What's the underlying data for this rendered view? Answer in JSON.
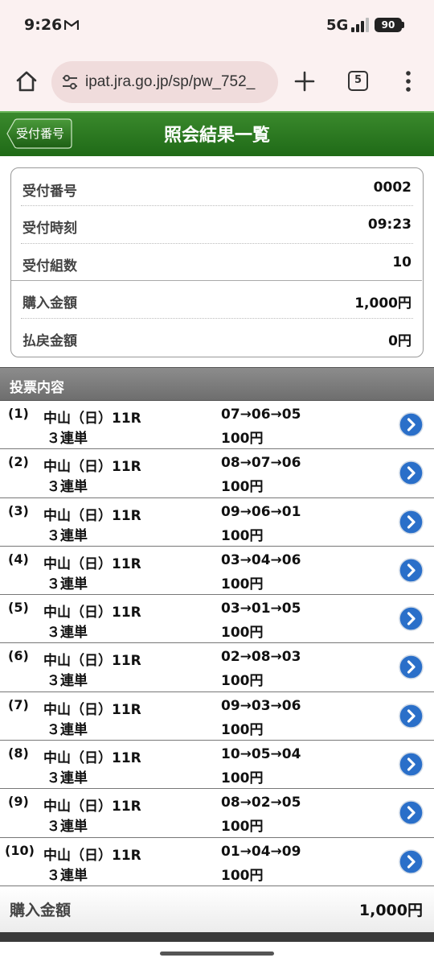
{
  "status_bar": {
    "time": "9:26",
    "network": "5G",
    "battery": "90",
    "icons": [
      "gmail-icon",
      "signal-icon",
      "battery-icon"
    ]
  },
  "browser": {
    "url": "ipat.jra.go.jp/sp/pw_752_",
    "tab_count": "5",
    "icons": [
      "home-icon",
      "tune-icon",
      "plus-icon",
      "tabs-icon",
      "more-vert-icon"
    ]
  },
  "header": {
    "back_label": "受付番号",
    "title": "照会結果一覧",
    "colors": {
      "header_green": "#2a7a20",
      "header_border": "#6ab55a"
    }
  },
  "info": {
    "rows": [
      {
        "label": "受付番号",
        "value": "0002"
      },
      {
        "label": "受付時刻",
        "value": "09:23"
      },
      {
        "label": "受付組数",
        "value": "10"
      },
      {
        "label": "購入金額",
        "value": "1,000円"
      },
      {
        "label": "払戻金額",
        "value": "0円"
      }
    ]
  },
  "section": {
    "title": "投票内容"
  },
  "bets": [
    {
      "num": "(1)",
      "race": "中山（日）11R",
      "type": "３連単",
      "combo": "07→06→05",
      "amount": "100円"
    },
    {
      "num": "(2)",
      "race": "中山（日）11R",
      "type": "３連単",
      "combo": "08→07→06",
      "amount": "100円"
    },
    {
      "num": "(3)",
      "race": "中山（日）11R",
      "type": "３連単",
      "combo": "09→06→01",
      "amount": "100円"
    },
    {
      "num": "(4)",
      "race": "中山（日）11R",
      "type": "３連単",
      "combo": "03→04→06",
      "amount": "100円"
    },
    {
      "num": "(5)",
      "race": "中山（日）11R",
      "type": "３連単",
      "combo": "03→01→05",
      "amount": "100円"
    },
    {
      "num": "(6)",
      "race": "中山（日）11R",
      "type": "３連単",
      "combo": "02→08→03",
      "amount": "100円"
    },
    {
      "num": "(7)",
      "race": "中山（日）11R",
      "type": "３連単",
      "combo": "09→03→06",
      "amount": "100円"
    },
    {
      "num": "(8)",
      "race": "中山（日）11R",
      "type": "３連単",
      "combo": "10→05→04",
      "amount": "100円"
    },
    {
      "num": "(9)",
      "race": "中山（日）11R",
      "type": "３連単",
      "combo": "08→02→05",
      "amount": "100円"
    },
    {
      "num": "(10)",
      "race": "中山（日）11R",
      "type": "３連単",
      "combo": "01→04→09",
      "amount": "100円"
    }
  ],
  "total": {
    "label": "購入金額",
    "value": "1,000円"
  },
  "colors": {
    "arrow_button": "#2a6fc9",
    "section_gray": "#7d7d7d",
    "chrome_pink": "#fbf1f1"
  }
}
